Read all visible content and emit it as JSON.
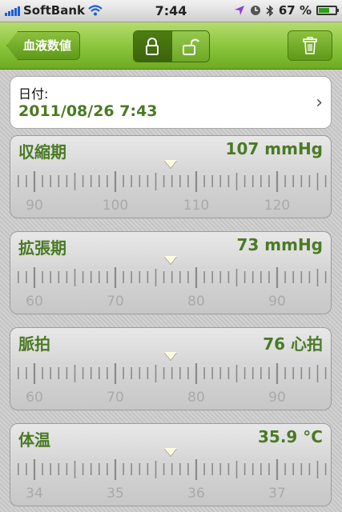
{
  "status_bar": {
    "carrier": "SoftBank",
    "time": "7:44",
    "battery": "67 %",
    "battery_level": 0.67
  },
  "nav": {
    "back_label": "血液数値"
  },
  "date": {
    "label": "日付:",
    "value": "2011/08/26 7:43"
  },
  "sliders": [
    {
      "name": "収縮期",
      "value": "107 mmHg",
      "ticks": [
        "90",
        "100",
        "110",
        "120"
      ],
      "tick_step": 10,
      "first_label": 90,
      "label_at": 0.1,
      "current": 107
    },
    {
      "name": "拡張期",
      "value": "73 mmHg",
      "ticks": [
        "60",
        "70",
        "80",
        "90"
      ],
      "tick_step": 10,
      "first_label": 60,
      "label_at": 0.1,
      "current": 73
    },
    {
      "name": "脈拍",
      "value": "76 心拍",
      "ticks": [
        "60",
        "70",
        "80",
        "90"
      ],
      "tick_step": 10,
      "first_label": 60,
      "label_at": 0.1,
      "current": 76
    },
    {
      "name": "体温",
      "value": "35.9 °C",
      "ticks": [
        "34",
        "35",
        "36",
        "37"
      ],
      "tick_step": 1,
      "first_label": 34,
      "label_at": 0.1,
      "current": 35.9
    }
  ]
}
